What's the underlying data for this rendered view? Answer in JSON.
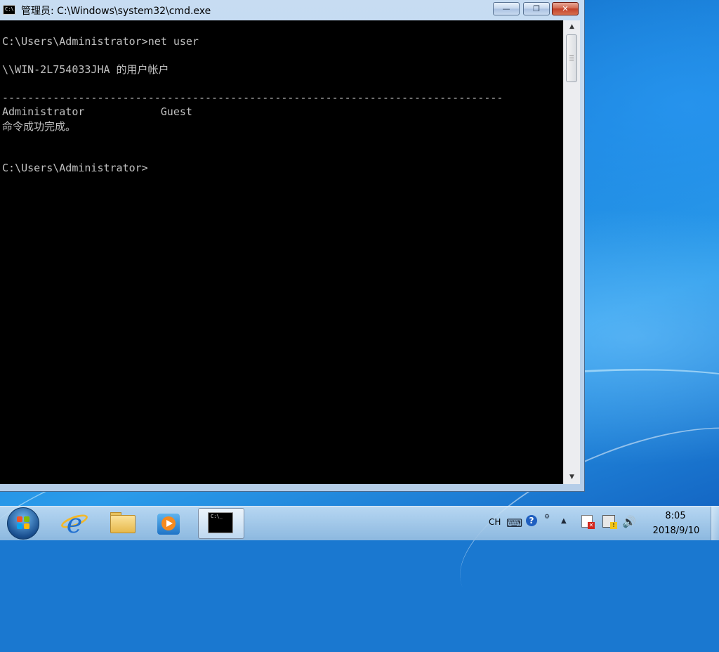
{
  "window": {
    "title": "管理员: C:\\Windows\\system32\\cmd.exe",
    "icon": "cmd-icon",
    "buttons": {
      "minimize": "—",
      "maximize": "❐",
      "close": "✕"
    }
  },
  "console": {
    "lines": [
      "C:\\Users\\Administrator>net user",
      "\\\\WIN-2L754033JHA 的用户帐户",
      "-------------------------------------------------------------------------------",
      "Administrator            Guest",
      "命令成功完成。",
      "C:\\Users\\Administrator>"
    ]
  },
  "scrollbar": {
    "up": "▲",
    "down": "▼"
  },
  "taskbar": {
    "pinned": [
      "start-button",
      "internet-explorer",
      "windows-explorer",
      "windows-media-player",
      "command-prompt"
    ],
    "tray": {
      "language": "CH",
      "keyboard": "⌨",
      "help": "?",
      "arrow": "▲",
      "volume": "🔊"
    },
    "clock": {
      "time": "8:05",
      "date": "2018/9/10"
    }
  }
}
